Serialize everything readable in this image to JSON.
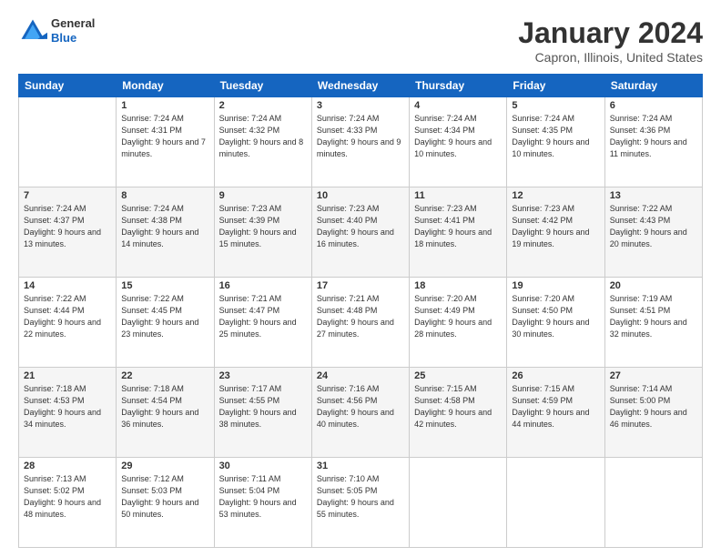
{
  "header": {
    "logo_line1": "General",
    "logo_line2": "Blue",
    "main_title": "January 2024",
    "subtitle": "Capron, Illinois, United States"
  },
  "columns": [
    "Sunday",
    "Monday",
    "Tuesday",
    "Wednesday",
    "Thursday",
    "Friday",
    "Saturday"
  ],
  "weeks": [
    [
      {
        "day": "",
        "sunrise": "",
        "sunset": "",
        "daylight": ""
      },
      {
        "day": "1",
        "sunrise": "Sunrise: 7:24 AM",
        "sunset": "Sunset: 4:31 PM",
        "daylight": "Daylight: 9 hours and 7 minutes."
      },
      {
        "day": "2",
        "sunrise": "Sunrise: 7:24 AM",
        "sunset": "Sunset: 4:32 PM",
        "daylight": "Daylight: 9 hours and 8 minutes."
      },
      {
        "day": "3",
        "sunrise": "Sunrise: 7:24 AM",
        "sunset": "Sunset: 4:33 PM",
        "daylight": "Daylight: 9 hours and 9 minutes."
      },
      {
        "day": "4",
        "sunrise": "Sunrise: 7:24 AM",
        "sunset": "Sunset: 4:34 PM",
        "daylight": "Daylight: 9 hours and 10 minutes."
      },
      {
        "day": "5",
        "sunrise": "Sunrise: 7:24 AM",
        "sunset": "Sunset: 4:35 PM",
        "daylight": "Daylight: 9 hours and 10 minutes."
      },
      {
        "day": "6",
        "sunrise": "Sunrise: 7:24 AM",
        "sunset": "Sunset: 4:36 PM",
        "daylight": "Daylight: 9 hours and 11 minutes."
      }
    ],
    [
      {
        "day": "7",
        "sunrise": "Sunrise: 7:24 AM",
        "sunset": "Sunset: 4:37 PM",
        "daylight": "Daylight: 9 hours and 13 minutes."
      },
      {
        "day": "8",
        "sunrise": "Sunrise: 7:24 AM",
        "sunset": "Sunset: 4:38 PM",
        "daylight": "Daylight: 9 hours and 14 minutes."
      },
      {
        "day": "9",
        "sunrise": "Sunrise: 7:23 AM",
        "sunset": "Sunset: 4:39 PM",
        "daylight": "Daylight: 9 hours and 15 minutes."
      },
      {
        "day": "10",
        "sunrise": "Sunrise: 7:23 AM",
        "sunset": "Sunset: 4:40 PM",
        "daylight": "Daylight: 9 hours and 16 minutes."
      },
      {
        "day": "11",
        "sunrise": "Sunrise: 7:23 AM",
        "sunset": "Sunset: 4:41 PM",
        "daylight": "Daylight: 9 hours and 18 minutes."
      },
      {
        "day": "12",
        "sunrise": "Sunrise: 7:23 AM",
        "sunset": "Sunset: 4:42 PM",
        "daylight": "Daylight: 9 hours and 19 minutes."
      },
      {
        "day": "13",
        "sunrise": "Sunrise: 7:22 AM",
        "sunset": "Sunset: 4:43 PM",
        "daylight": "Daylight: 9 hours and 20 minutes."
      }
    ],
    [
      {
        "day": "14",
        "sunrise": "Sunrise: 7:22 AM",
        "sunset": "Sunset: 4:44 PM",
        "daylight": "Daylight: 9 hours and 22 minutes."
      },
      {
        "day": "15",
        "sunrise": "Sunrise: 7:22 AM",
        "sunset": "Sunset: 4:45 PM",
        "daylight": "Daylight: 9 hours and 23 minutes."
      },
      {
        "day": "16",
        "sunrise": "Sunrise: 7:21 AM",
        "sunset": "Sunset: 4:47 PM",
        "daylight": "Daylight: 9 hours and 25 minutes."
      },
      {
        "day": "17",
        "sunrise": "Sunrise: 7:21 AM",
        "sunset": "Sunset: 4:48 PM",
        "daylight": "Daylight: 9 hours and 27 minutes."
      },
      {
        "day": "18",
        "sunrise": "Sunrise: 7:20 AM",
        "sunset": "Sunset: 4:49 PM",
        "daylight": "Daylight: 9 hours and 28 minutes."
      },
      {
        "day": "19",
        "sunrise": "Sunrise: 7:20 AM",
        "sunset": "Sunset: 4:50 PM",
        "daylight": "Daylight: 9 hours and 30 minutes."
      },
      {
        "day": "20",
        "sunrise": "Sunrise: 7:19 AM",
        "sunset": "Sunset: 4:51 PM",
        "daylight": "Daylight: 9 hours and 32 minutes."
      }
    ],
    [
      {
        "day": "21",
        "sunrise": "Sunrise: 7:18 AM",
        "sunset": "Sunset: 4:53 PM",
        "daylight": "Daylight: 9 hours and 34 minutes."
      },
      {
        "day": "22",
        "sunrise": "Sunrise: 7:18 AM",
        "sunset": "Sunset: 4:54 PM",
        "daylight": "Daylight: 9 hours and 36 minutes."
      },
      {
        "day": "23",
        "sunrise": "Sunrise: 7:17 AM",
        "sunset": "Sunset: 4:55 PM",
        "daylight": "Daylight: 9 hours and 38 minutes."
      },
      {
        "day": "24",
        "sunrise": "Sunrise: 7:16 AM",
        "sunset": "Sunset: 4:56 PM",
        "daylight": "Daylight: 9 hours and 40 minutes."
      },
      {
        "day": "25",
        "sunrise": "Sunrise: 7:15 AM",
        "sunset": "Sunset: 4:58 PM",
        "daylight": "Daylight: 9 hours and 42 minutes."
      },
      {
        "day": "26",
        "sunrise": "Sunrise: 7:15 AM",
        "sunset": "Sunset: 4:59 PM",
        "daylight": "Daylight: 9 hours and 44 minutes."
      },
      {
        "day": "27",
        "sunrise": "Sunrise: 7:14 AM",
        "sunset": "Sunset: 5:00 PM",
        "daylight": "Daylight: 9 hours and 46 minutes."
      }
    ],
    [
      {
        "day": "28",
        "sunrise": "Sunrise: 7:13 AM",
        "sunset": "Sunset: 5:02 PM",
        "daylight": "Daylight: 9 hours and 48 minutes."
      },
      {
        "day": "29",
        "sunrise": "Sunrise: 7:12 AM",
        "sunset": "Sunset: 5:03 PM",
        "daylight": "Daylight: 9 hours and 50 minutes."
      },
      {
        "day": "30",
        "sunrise": "Sunrise: 7:11 AM",
        "sunset": "Sunset: 5:04 PM",
        "daylight": "Daylight: 9 hours and 53 minutes."
      },
      {
        "day": "31",
        "sunrise": "Sunrise: 7:10 AM",
        "sunset": "Sunset: 5:05 PM",
        "daylight": "Daylight: 9 hours and 55 minutes."
      },
      {
        "day": "",
        "sunrise": "",
        "sunset": "",
        "daylight": ""
      },
      {
        "day": "",
        "sunrise": "",
        "sunset": "",
        "daylight": ""
      },
      {
        "day": "",
        "sunrise": "",
        "sunset": "",
        "daylight": ""
      }
    ]
  ]
}
